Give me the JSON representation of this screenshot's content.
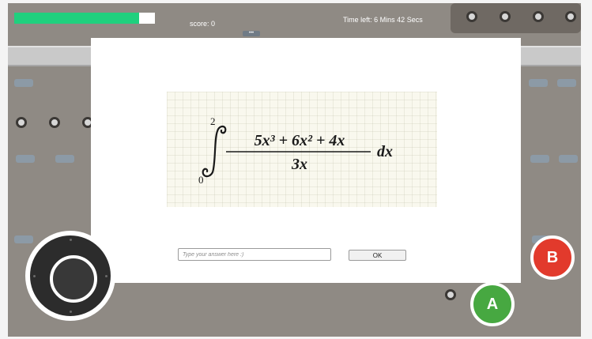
{
  "hud": {
    "health_fraction": 0.89,
    "score_text": "score:  0",
    "time_text": "Time left: 6 Mins 42 Secs",
    "menu_label": "•••"
  },
  "quiz": {
    "integral": {
      "lower_limit": "0",
      "upper_limit": "2",
      "numerator": "5x³ + 6x² + 4x",
      "denominator": "3x",
      "differential": "dx"
    },
    "answer_placeholder": "Type your answer here :)",
    "ok_label": "OK"
  },
  "controls": {
    "a_label": "A",
    "b_label": "B"
  },
  "colors": {
    "health": "#1fd07e",
    "button_a": "#47a841",
    "button_b": "#e23a2c"
  }
}
